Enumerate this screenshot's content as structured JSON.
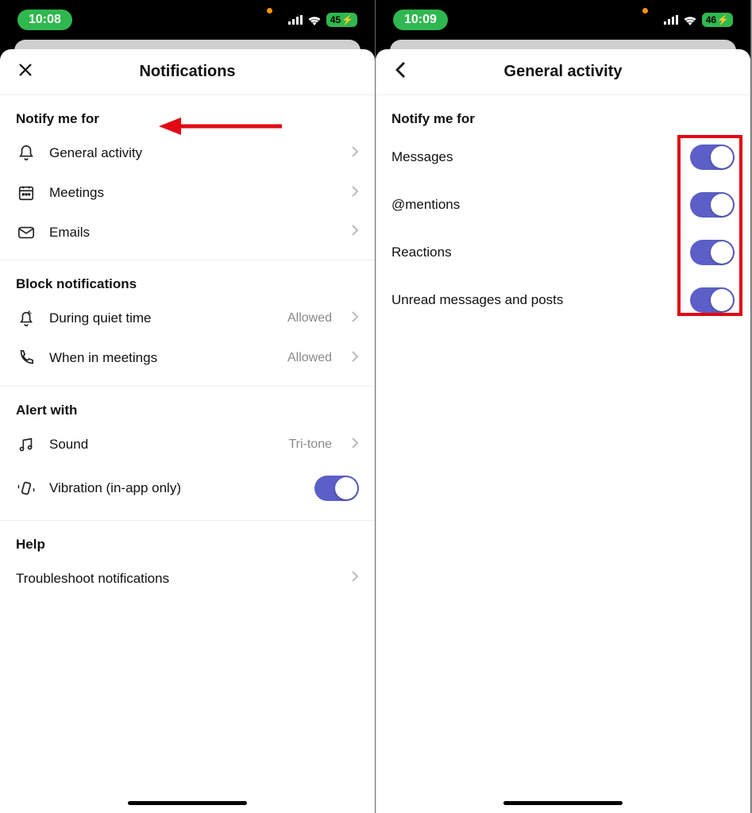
{
  "left": {
    "statusbar": {
      "time": "10:08",
      "battery": "45"
    },
    "title": "Notifications",
    "sections": {
      "notify_me_for": {
        "heading": "Notify me for",
        "general_activity": "General activity",
        "meetings": "Meetings",
        "emails": "Emails"
      },
      "block": {
        "heading": "Block notifications",
        "quiet_time": {
          "label": "During quiet time",
          "value": "Allowed"
        },
        "in_meetings": {
          "label": "When in meetings",
          "value": "Allowed"
        }
      },
      "alert": {
        "heading": "Alert with",
        "sound": {
          "label": "Sound",
          "value": "Tri-tone"
        },
        "vibration": {
          "label": "Vibration (in-app only)",
          "on": true
        }
      },
      "help": {
        "heading": "Help",
        "troubleshoot": "Troubleshoot notifications"
      }
    }
  },
  "right": {
    "statusbar": {
      "time": "10:09",
      "battery": "46"
    },
    "title": "General activity",
    "section_heading": "Notify me for",
    "items": {
      "messages": "Messages",
      "mentions": "@mentions",
      "reactions": "Reactions",
      "unread": "Unread messages and posts"
    }
  }
}
